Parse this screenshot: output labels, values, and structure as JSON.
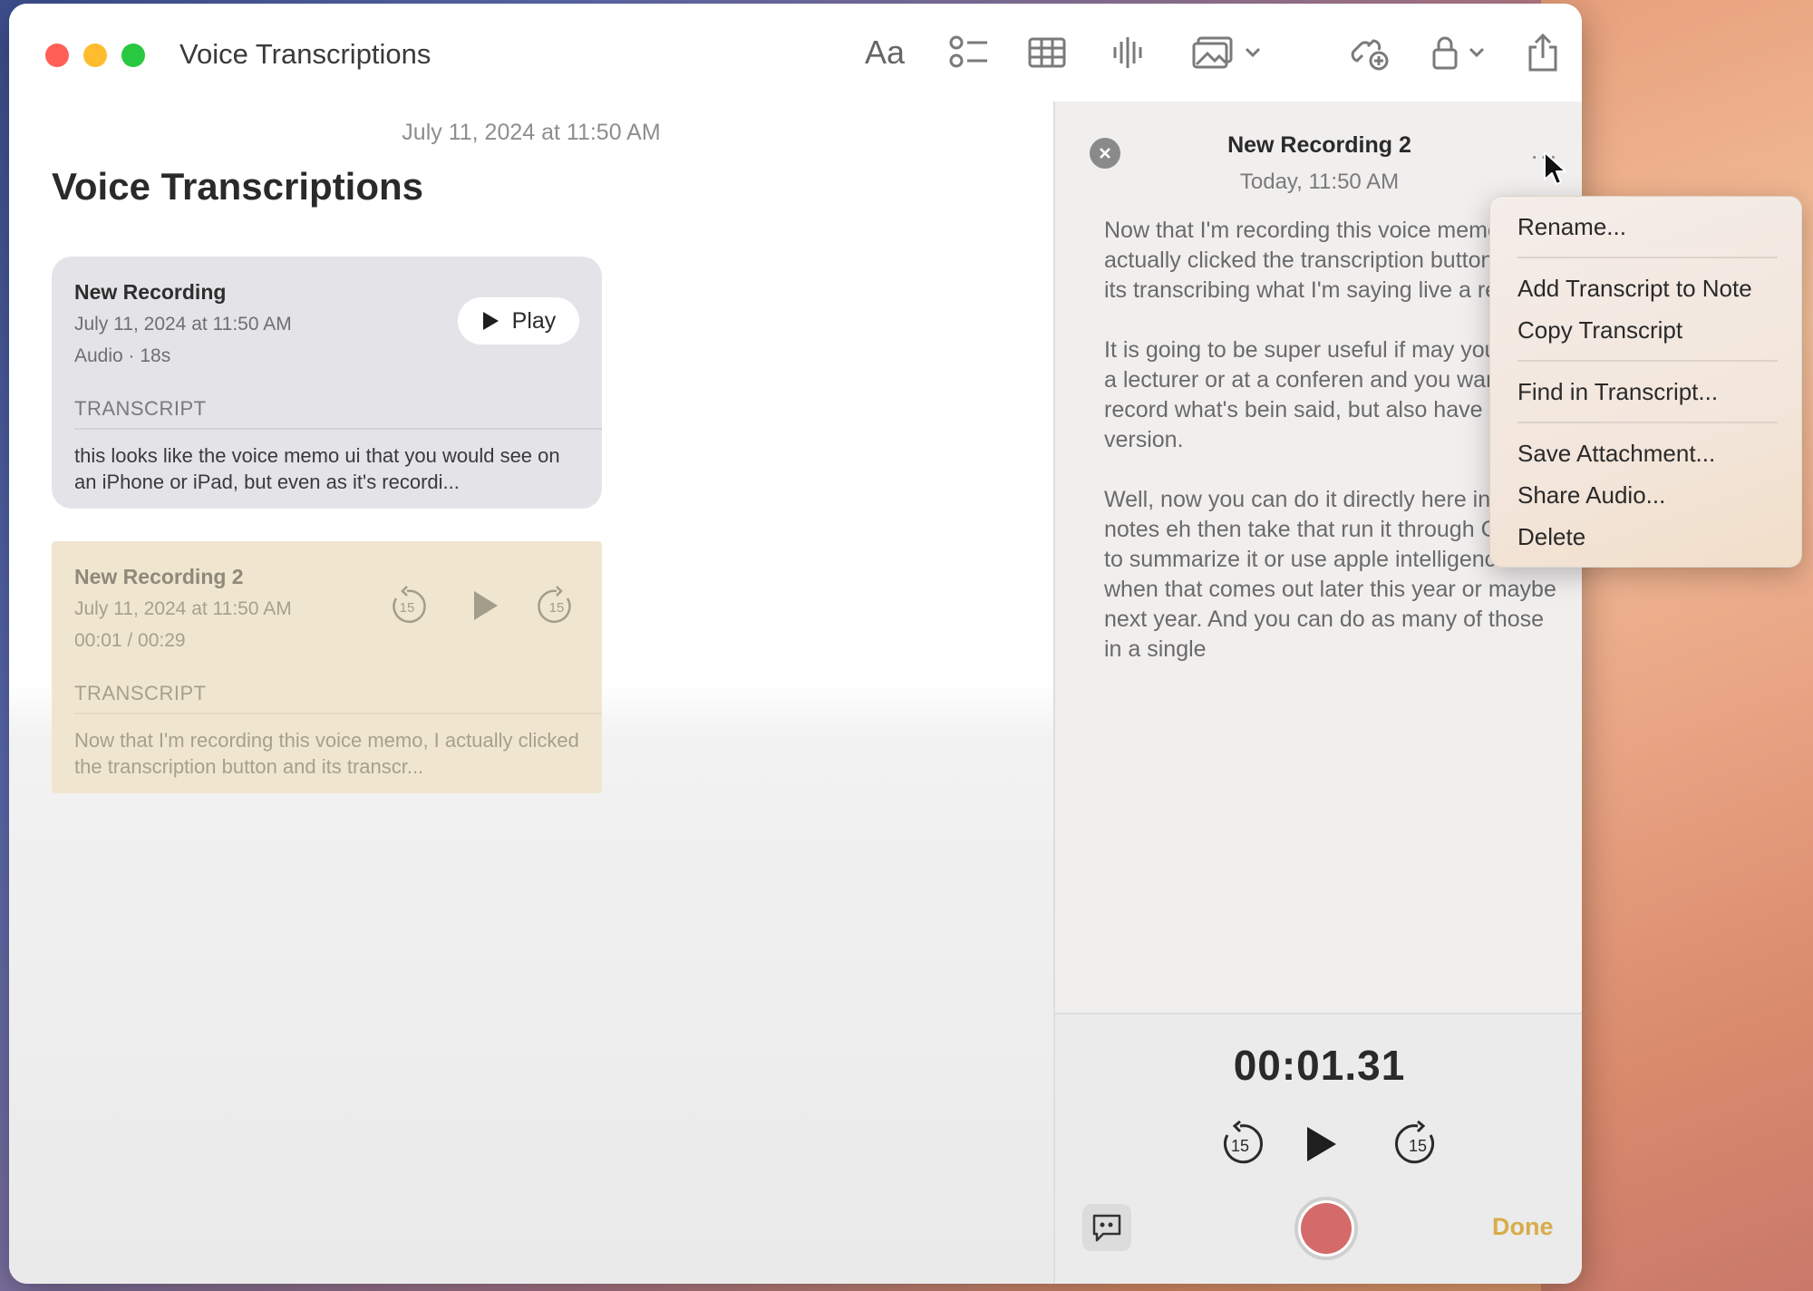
{
  "window": {
    "title": "Voice Transcriptions",
    "toolbar": {
      "format_label": "Aa",
      "icons": [
        "checklist-icon",
        "table-icon",
        "audio-waveform-icon",
        "media-icon",
        "collaborate-icon",
        "lock-icon",
        "share-icon"
      ]
    }
  },
  "note": {
    "date": "July 11, 2024 at 11:50 AM",
    "title": "Voice Transcriptions",
    "recordings": [
      {
        "name": "New Recording",
        "date": "July 11, 2024 at 11:50 AM",
        "meta": "Audio · 18s",
        "play_label": "Play",
        "section": "TRANSCRIPT",
        "transcript": "this looks like the voice memo ui that you would see on an iPhone or iPad, but even as it's recordi..."
      },
      {
        "name": "New Recording 2",
        "date": "July 11, 2024 at 11:50 AM",
        "meta": "00:01 / 00:29",
        "skip_back": "15",
        "skip_forward": "15",
        "section": "TRANSCRIPT",
        "transcript": "Now that I'm recording this voice memo, I actually clicked the transcription button and its transcr..."
      }
    ]
  },
  "panel": {
    "title": "New Recording 2",
    "subtitle": "Today, 11:50 AM",
    "more_label": "···",
    "paragraphs": [
      "Now that I'm recording this voice memo, I actually clicked the transcription button and its transcribing what I'm saying live a record.",
      "It is going to be super useful if may you're in a lecturer or at a conferen and you want to record what's bein said, but also have a text version.",
      "Well, now you can do it directly here in the notes eh then take that run it through Chi tea to summarize it or use apple intelligence when that comes out later this year or maybe next year. And you can do as many of those in a single"
    ],
    "timer": "00:01.31",
    "skip_back": "15",
    "skip_forward": "15",
    "done_label": "Done"
  },
  "menu": {
    "items": [
      "Rename...",
      "Add Transcript to Note",
      "Copy Transcript",
      "Find in Transcript...",
      "Save Attachment...",
      "Share Audio...",
      "Delete"
    ]
  },
  "colors": {
    "accent_done": "#d8ac4a",
    "record_red": "#d46a6a",
    "selected_card": "#f0e6cf"
  }
}
